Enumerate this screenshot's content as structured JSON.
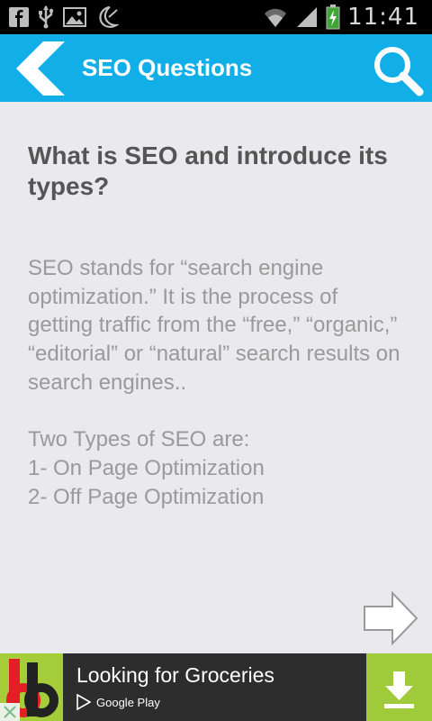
{
  "status_bar": {
    "time": "11:41",
    "left_icons": [
      "facebook-icon",
      "usb-icon",
      "image-icon",
      "moon-icon"
    ],
    "right_icons": [
      "wifi-icon",
      "signal-icon",
      "battery-charging-icon"
    ]
  },
  "app_bar": {
    "title": "SEO Questions",
    "color": "#12aee8"
  },
  "question": {
    "title": "What is SEO and introduce its types?",
    "answer": "SEO stands for “search engine optimization.” It is the process of getting traffic from the “free,” “organic,” “editorial” or “natural” search results on search engines..\n\nTwo Types of SEO are:\n1- On Page Optimization\n2- Off Page Optimization"
  },
  "ad": {
    "title": "Looking for Groceries",
    "store_label": "Google Play",
    "logo_colors": [
      "#a5cd39",
      "#e31e24"
    ],
    "download_color": "#9fcb3a"
  }
}
